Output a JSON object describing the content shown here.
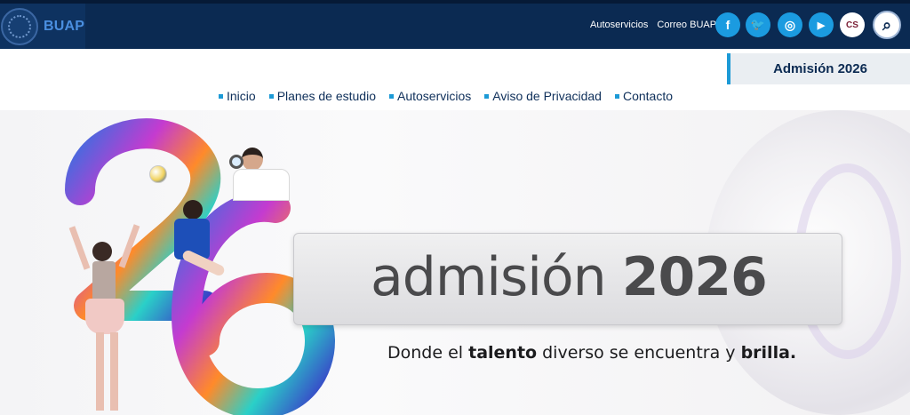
{
  "header": {
    "brand": "BUAP",
    "links": [
      "Autoservicios",
      "Correo BUAP"
    ],
    "social": [
      {
        "name": "facebook-icon",
        "glyph": "f"
      },
      {
        "name": "twitter-icon",
        "glyph": "🐦"
      },
      {
        "name": "instagram-icon",
        "glyph": "◎"
      },
      {
        "name": "youtube-icon",
        "glyph": "▶"
      },
      {
        "name": "cs-icon",
        "glyph": "CS"
      },
      {
        "name": "search-icon",
        "glyph": "⌕"
      }
    ]
  },
  "admission_tab": {
    "label": "Admisión 2026"
  },
  "nav": {
    "items": [
      "Inicio",
      "Planes de estudio",
      "Autoservicios",
      "Aviso de Privacidad",
      "Contacto"
    ]
  },
  "hero": {
    "title_prefix": "admisión",
    "title_year": "2026",
    "tagline_parts": [
      "Donde el ",
      "talento",
      " diverso se encuentra y ",
      "brilla."
    ]
  },
  "colors": {
    "topbar": "#0b2a52",
    "accent": "#1c9ad6",
    "social": "#1b9be0"
  }
}
